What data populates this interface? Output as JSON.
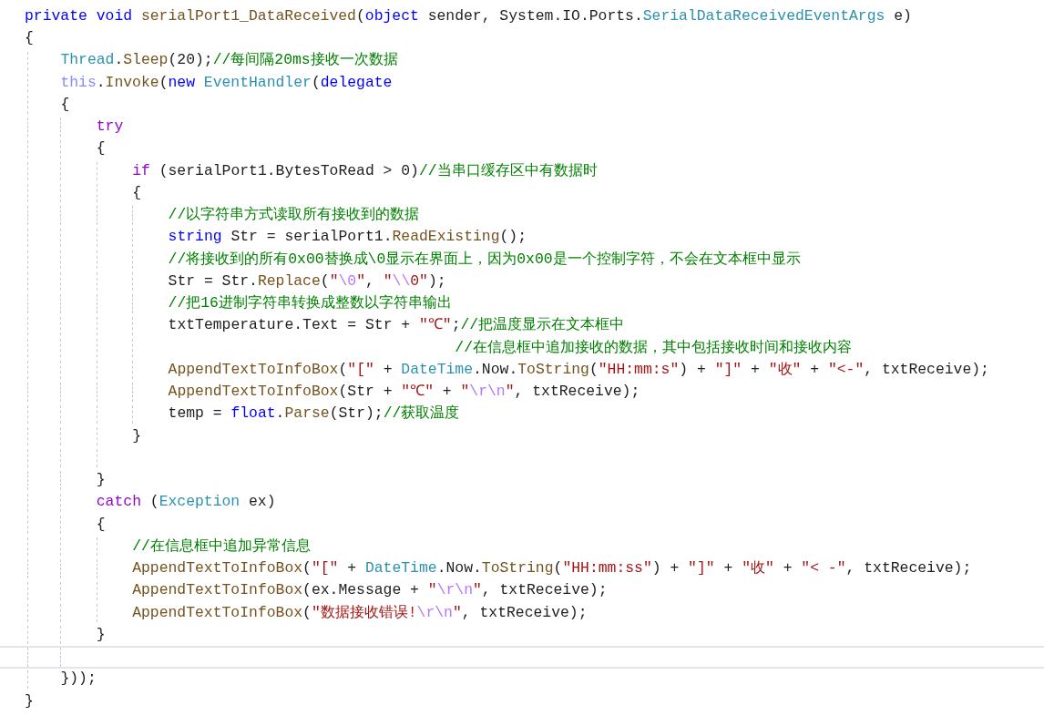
{
  "editor": {
    "lines": [
      {
        "current": false,
        "tokens": [
          {
            "text": "private ",
            "kind": "keyword"
          },
          {
            "text": "void ",
            "kind": "keyword"
          },
          {
            "text": "serialPort1_DataReceived",
            "kind": "method"
          },
          {
            "text": "(",
            "kind": "plain"
          },
          {
            "text": "object",
            "kind": "keyword"
          },
          {
            "text": " sender, System.IO.Ports.",
            "kind": "plain"
          },
          {
            "text": "SerialDataReceivedEventArgs",
            "kind": "type"
          },
          {
            "text": " e)",
            "kind": "plain"
          }
        ]
      },
      {
        "current": false,
        "tokens": [
          {
            "text": "{",
            "kind": "plain"
          }
        ],
        "children": [
          {
            "current": false,
            "tokens": [
              {
                "text": "Thread",
                "kind": "type"
              },
              {
                "text": ".",
                "kind": "plain"
              },
              {
                "text": "Sleep",
                "kind": "method"
              },
              {
                "text": "(20);",
                "kind": "plain"
              },
              {
                "text": "//每间隔20ms接收一次数据",
                "kind": "comment"
              }
            ]
          },
          {
            "current": false,
            "tokens": [
              {
                "text": "this",
                "kind": "self"
              },
              {
                "text": ".",
                "kind": "plain"
              },
              {
                "text": "Invoke",
                "kind": "method"
              },
              {
                "text": "(",
                "kind": "plain"
              },
              {
                "text": "new ",
                "kind": "keyword"
              },
              {
                "text": "EventHandler",
                "kind": "type"
              },
              {
                "text": "(",
                "kind": "plain"
              },
              {
                "text": "delegate",
                "kind": "keyword"
              }
            ]
          },
          {
            "current": false,
            "tokens": [
              {
                "text": "{",
                "kind": "plain"
              }
            ],
            "children": [
              {
                "current": false,
                "tokens": [
                  {
                    "text": "try",
                    "kind": "control"
                  }
                ]
              },
              {
                "current": false,
                "tokens": [
                  {
                    "text": "{",
                    "kind": "plain"
                  }
                ],
                "children": [
                  {
                    "current": false,
                    "tokens": [
                      {
                        "text": "if",
                        "kind": "control"
                      },
                      {
                        "text": " (serialPort1.BytesToRead > 0)",
                        "kind": "plain"
                      },
                      {
                        "text": "//当串口缓存区中有数据时",
                        "kind": "comment"
                      }
                    ]
                  },
                  {
                    "current": false,
                    "tokens": [
                      {
                        "text": "{",
                        "kind": "plain"
                      }
                    ],
                    "children": [
                      {
                        "current": false,
                        "tokens": [
                          {
                            "text": "//以字符串方式读取所有接收到的数据",
                            "kind": "comment"
                          }
                        ]
                      },
                      {
                        "current": false,
                        "tokens": [
                          {
                            "text": "string",
                            "kind": "keyword"
                          },
                          {
                            "text": " Str = serialPort1.",
                            "kind": "plain"
                          },
                          {
                            "text": "ReadExisting",
                            "kind": "method"
                          },
                          {
                            "text": "();",
                            "kind": "plain"
                          }
                        ]
                      },
                      {
                        "current": false,
                        "tokens": [
                          {
                            "text": "//将接收到的所有0x00替换成\\0显示在界面上，因为0x00是一个控制字符，不会在文本框中显示",
                            "kind": "comment"
                          }
                        ]
                      },
                      {
                        "current": false,
                        "tokens": [
                          {
                            "text": "Str = Str.",
                            "kind": "plain"
                          },
                          {
                            "text": "Replace",
                            "kind": "method"
                          },
                          {
                            "text": "(",
                            "kind": "plain"
                          },
                          {
                            "text": "\"",
                            "kind": "string"
                          },
                          {
                            "text": "\\0",
                            "kind": "escape"
                          },
                          {
                            "text": "\"",
                            "kind": "string"
                          },
                          {
                            "text": ", ",
                            "kind": "plain"
                          },
                          {
                            "text": "\"",
                            "kind": "string"
                          },
                          {
                            "text": "\\\\",
                            "kind": "escape"
                          },
                          {
                            "text": "0\"",
                            "kind": "string"
                          },
                          {
                            "text": ");",
                            "kind": "plain"
                          }
                        ]
                      },
                      {
                        "current": false,
                        "tokens": [
                          {
                            "text": "//把16进制字符串转换成整数以字符串输出",
                            "kind": "comment"
                          }
                        ]
                      },
                      {
                        "current": false,
                        "tokens": [
                          {
                            "text": "txtTemperature.Text = Str + ",
                            "kind": "plain"
                          },
                          {
                            "text": "\"℃\"",
                            "kind": "string"
                          },
                          {
                            "text": ";",
                            "kind": "plain"
                          },
                          {
                            "text": "//把温度显示在文本框中",
                            "kind": "comment"
                          }
                        ]
                      },
                      {
                        "current": false,
                        "tokens": [
                          {
                            "text": "                                //在信息框中追加接收的数据，其中包括接收时间和接收内容",
                            "kind": "comment"
                          }
                        ]
                      },
                      {
                        "current": false,
                        "tokens": [
                          {
                            "text": "AppendTextToInfoBox",
                            "kind": "method"
                          },
                          {
                            "text": "(",
                            "kind": "plain"
                          },
                          {
                            "text": "\"[\"",
                            "kind": "string"
                          },
                          {
                            "text": " + ",
                            "kind": "plain"
                          },
                          {
                            "text": "DateTime",
                            "kind": "type"
                          },
                          {
                            "text": ".Now.",
                            "kind": "plain"
                          },
                          {
                            "text": "ToString",
                            "kind": "method"
                          },
                          {
                            "text": "(",
                            "kind": "plain"
                          },
                          {
                            "text": "\"HH:mm:s\"",
                            "kind": "string"
                          },
                          {
                            "text": ") + ",
                            "kind": "plain"
                          },
                          {
                            "text": "\"]\"",
                            "kind": "string"
                          },
                          {
                            "text": " + ",
                            "kind": "plain"
                          },
                          {
                            "text": "\"收\"",
                            "kind": "string"
                          },
                          {
                            "text": " + ",
                            "kind": "plain"
                          },
                          {
                            "text": "\"<-\"",
                            "kind": "string"
                          },
                          {
                            "text": ", txtReceive);",
                            "kind": "plain"
                          }
                        ]
                      },
                      {
                        "current": false,
                        "tokens": [
                          {
                            "text": "AppendTextToInfoBox",
                            "kind": "method"
                          },
                          {
                            "text": "(Str + ",
                            "kind": "plain"
                          },
                          {
                            "text": "\"℃\"",
                            "kind": "string"
                          },
                          {
                            "text": " + ",
                            "kind": "plain"
                          },
                          {
                            "text": "\"",
                            "kind": "string"
                          },
                          {
                            "text": "\\r\\n",
                            "kind": "escape"
                          },
                          {
                            "text": "\"",
                            "kind": "string"
                          },
                          {
                            "text": ", txtReceive);",
                            "kind": "plain"
                          }
                        ]
                      },
                      {
                        "current": false,
                        "tokens": [
                          {
                            "text": "temp = ",
                            "kind": "plain"
                          },
                          {
                            "text": "float",
                            "kind": "keyword"
                          },
                          {
                            "text": ".",
                            "kind": "plain"
                          },
                          {
                            "text": "Parse",
                            "kind": "method"
                          },
                          {
                            "text": "(Str);",
                            "kind": "plain"
                          },
                          {
                            "text": "//获取温度",
                            "kind": "comment"
                          }
                        ]
                      }
                    ]
                  },
                  {
                    "current": false,
                    "tokens": [
                      {
                        "text": "}",
                        "kind": "plain"
                      }
                    ]
                  },
                  {
                    "current": false
                  }
                ]
              },
              {
                "current": false,
                "tokens": [
                  {
                    "text": "}",
                    "kind": "plain"
                  }
                ]
              },
              {
                "current": false,
                "tokens": [
                  {
                    "text": "catch",
                    "kind": "control"
                  },
                  {
                    "text": " (",
                    "kind": "plain"
                  },
                  {
                    "text": "Exception",
                    "kind": "type"
                  },
                  {
                    "text": " ex)",
                    "kind": "plain"
                  }
                ]
              },
              {
                "current": false,
                "tokens": [
                  {
                    "text": "{",
                    "kind": "plain"
                  }
                ],
                "children": [
                  {
                    "current": false,
                    "tokens": [
                      {
                        "text": "//在信息框中追加异常信息",
                        "kind": "comment"
                      }
                    ]
                  },
                  {
                    "current": false,
                    "tokens": [
                      {
                        "text": "AppendTextToInfoBox",
                        "kind": "method"
                      },
                      {
                        "text": "(",
                        "kind": "plain"
                      },
                      {
                        "text": "\"[\"",
                        "kind": "string"
                      },
                      {
                        "text": " + ",
                        "kind": "plain"
                      },
                      {
                        "text": "DateTime",
                        "kind": "type"
                      },
                      {
                        "text": ".Now.",
                        "kind": "plain"
                      },
                      {
                        "text": "ToString",
                        "kind": "method"
                      },
                      {
                        "text": "(",
                        "kind": "plain"
                      },
                      {
                        "text": "\"HH:mm:ss\"",
                        "kind": "string"
                      },
                      {
                        "text": ") + ",
                        "kind": "plain"
                      },
                      {
                        "text": "\"]\"",
                        "kind": "string"
                      },
                      {
                        "text": " + ",
                        "kind": "plain"
                      },
                      {
                        "text": "\"收\"",
                        "kind": "string"
                      },
                      {
                        "text": " + ",
                        "kind": "plain"
                      },
                      {
                        "text": "\"< -\"",
                        "kind": "string"
                      },
                      {
                        "text": ", txtReceive);",
                        "kind": "plain"
                      }
                    ]
                  },
                  {
                    "current": false,
                    "tokens": [
                      {
                        "text": "AppendTextToInfoBox",
                        "kind": "method"
                      },
                      {
                        "text": "(ex.Message + ",
                        "kind": "plain"
                      },
                      {
                        "text": "\"",
                        "kind": "string"
                      },
                      {
                        "text": "\\r\\n",
                        "kind": "escape"
                      },
                      {
                        "text": "\"",
                        "kind": "string"
                      },
                      {
                        "text": ", txtReceive);",
                        "kind": "plain"
                      }
                    ]
                  },
                  {
                    "current": false,
                    "tokens": [
                      {
                        "text": "AppendTextToInfoBox",
                        "kind": "method"
                      },
                      {
                        "text": "(",
                        "kind": "plain"
                      },
                      {
                        "text": "\"数据接收错误!",
                        "kind": "string"
                      },
                      {
                        "text": "\\r\\n",
                        "kind": "escape"
                      },
                      {
                        "text": "\"",
                        "kind": "string"
                      },
                      {
                        "text": ", txtReceive);",
                        "kind": "plain"
                      }
                    ]
                  }
                ]
              },
              {
                "current": false,
                "tokens": [
                  {
                    "text": "}",
                    "kind": "plain"
                  }
                ]
              },
              {
                "current": true
              }
            ]
          },
          {
            "current": false,
            "tokens": [
              {
                "text": "}));",
                "kind": "plain"
              }
            ]
          }
        ]
      },
      {
        "current": false,
        "tokens": [
          {
            "text": "}",
            "kind": "plain"
          }
        ]
      }
    ]
  }
}
